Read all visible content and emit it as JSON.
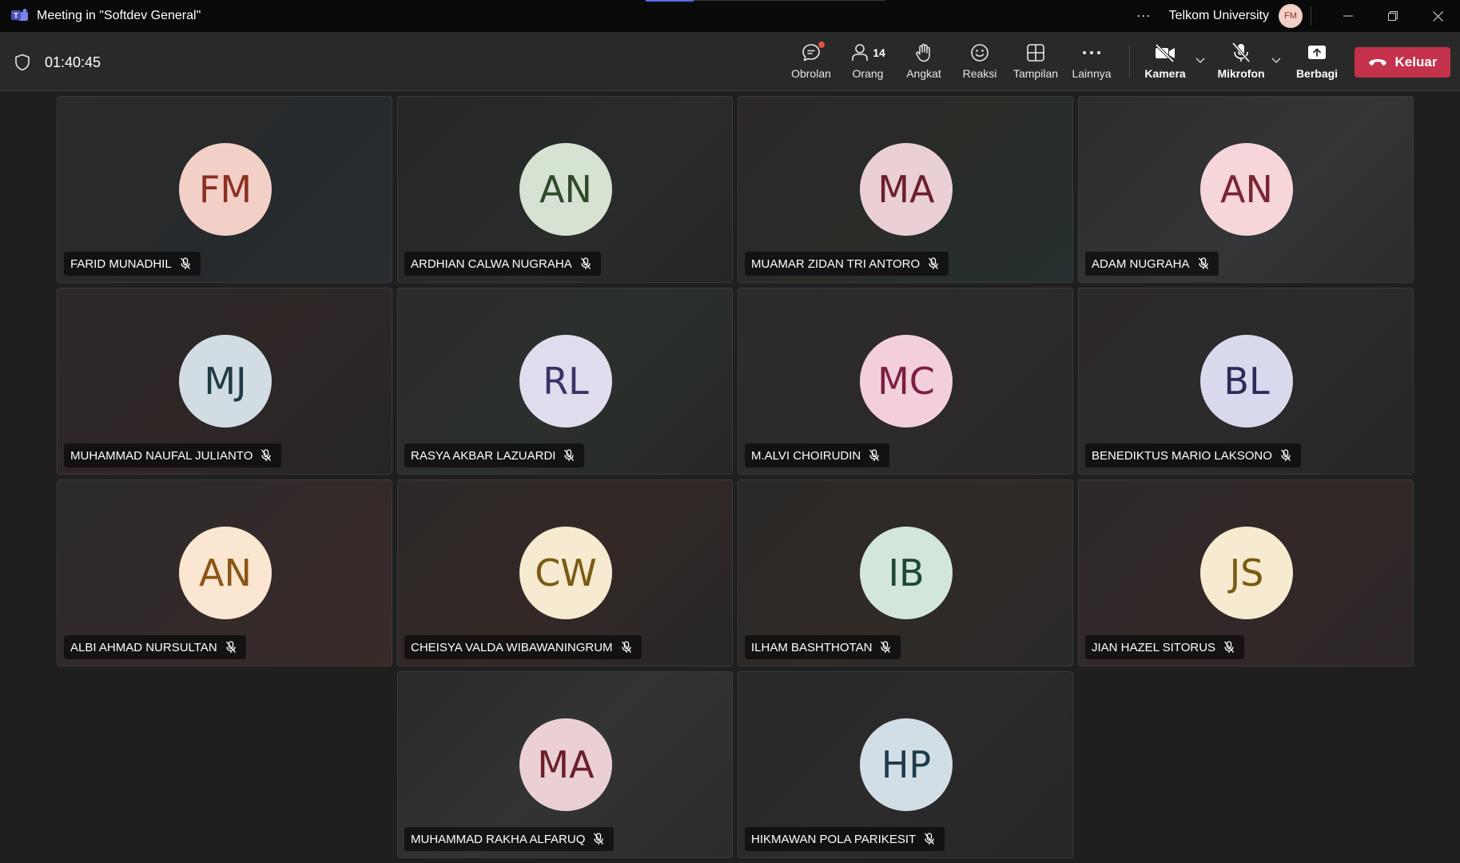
{
  "window": {
    "title": "Meeting in \"Softdev General\"",
    "org": "Telkom University",
    "user_initials": "FM",
    "more_icon": "⋯"
  },
  "toolbar": {
    "timer": "01:40:45",
    "chat_label": "Obrolan",
    "people_label": "Orang",
    "people_count": "14",
    "raise_label": "Angkat",
    "react_label": "Reaksi",
    "view_label": "Tampilan",
    "more_label": "Lainnya",
    "camera_label": "Kamera",
    "mic_label": "Mikrofon",
    "share_label": "Berbagi",
    "leave_label": "Keluar"
  },
  "colors": {
    "leave_button": "#c4314b",
    "notification_dot": "#e0533a",
    "accent": "#4f6bed"
  },
  "participants": [
    {
      "name": "FARID MUNADHIL",
      "initials": "FM",
      "avatar_bg": "#f3d0c7",
      "avatar_fg": "#8b2f22",
      "tile_bg": "linear-gradient(135deg,#2c2a2a,#262a2c 60%,#2a2d2f)",
      "muted": true
    },
    {
      "name": "ARDHIAN CALWA NUGRAHA",
      "initials": "AN",
      "avatar_bg": "#d6e2d2",
      "avatar_fg": "#2f4a2a",
      "tile_bg": "linear-gradient(135deg,#262626,#2a2b2b 60%,#242526)",
      "muted": true
    },
    {
      "name": "MUAMAR ZIDAN TRI ANTORO",
      "initials": "MA",
      "avatar_bg": "#ead0d4",
      "avatar_fg": "#6b1f2a",
      "tile_bg": "linear-gradient(135deg,#2b2827,#2a2c28 50%,#263030)",
      "muted": true
    },
    {
      "name": "ADAM NUGRAHA",
      "initials": "AN",
      "avatar_bg": "#f6d6d9",
      "avatar_fg": "#7a2531",
      "tile_bg": "linear-gradient(135deg,#2c2d2e,#333537 60%,#2c2c2c)",
      "muted": true
    },
    {
      "name": "MUHAMMAD NAUFAL JULIANTO",
      "initials": "MJ",
      "avatar_bg": "#d2dde3",
      "avatar_fg": "#1f3a45",
      "tile_bg": "linear-gradient(135deg,#2c2828,#2f2626 50%,#262525)",
      "muted": true
    },
    {
      "name": "RASYA AKBAR LAZUARDI",
      "initials": "RL",
      "avatar_bg": "#e1dcee",
      "avatar_fg": "#3d3266",
      "tile_bg": "linear-gradient(135deg,#2c2b2a,#2b302d 50%,#252727)",
      "muted": true
    },
    {
      "name": "M.ALVI CHOIRUDIN",
      "initials": "MC",
      "avatar_bg": "#f3cfdc",
      "avatar_fg": "#7a1f42",
      "tile_bg": "linear-gradient(135deg,#2b2b2d,#2d2a2c 50%,#292728)",
      "muted": true
    },
    {
      "name": "BENEDIKTUS MARIO LAKSONO",
      "initials": "BL",
      "avatar_bg": "#d9d9ee",
      "avatar_fg": "#2d2d5c",
      "tile_bg": "linear-gradient(135deg,#2b2828,#2d2a2a 50%,#262626)",
      "muted": true
    },
    {
      "name": "ALBI AHMAD NURSULTAN",
      "initials": "AN",
      "avatar_bg": "#fbe6d1",
      "avatar_fg": "#8a5516",
      "tile_bg": "linear-gradient(135deg,#2b2a2a,#332a2a 50%,#3a2a2a)",
      "muted": true
    },
    {
      "name": "CHEISYA VALDA WIBAWANINGRUM",
      "initials": "CW",
      "avatar_bg": "#f6ead0",
      "avatar_fg": "#7a5a12",
      "tile_bg": "linear-gradient(135deg,#2b2827,#332927 50%,#262525)",
      "muted": true
    },
    {
      "name": "ILHAM BASHTHOTAN",
      "initials": "IB",
      "avatar_bg": "#d2e6d9",
      "avatar_fg": "#1f4a32",
      "tile_bg": "linear-gradient(135deg,#292726,#302b27 50%,#2a2829)",
      "muted": true
    },
    {
      "name": "JIAN HAZEL SITORUS",
      "initials": "JS",
      "avatar_bg": "#f6ead0",
      "avatar_fg": "#7a5a12",
      "tile_bg": "linear-gradient(135deg,#2b2828,#332828 50%,#2c2626)",
      "muted": true
    },
    {
      "name": "MUHAMMAD RAKHA ALFARUQ",
      "initials": "MA",
      "avatar_bg": "#ead0d4",
      "avatar_fg": "#6b1f2a",
      "tile_bg": "linear-gradient(135deg,#2a2a2a,#333333 50%,#2c2c2c)",
      "muted": true
    },
    {
      "name": "HIKMAWAN POLA PARIKESIT",
      "initials": "HP",
      "avatar_bg": "#d2dee6",
      "avatar_fg": "#1f3a4a",
      "tile_bg": "linear-gradient(135deg,#282828,#2c2a2a 50%,#262626)",
      "muted": true
    }
  ]
}
